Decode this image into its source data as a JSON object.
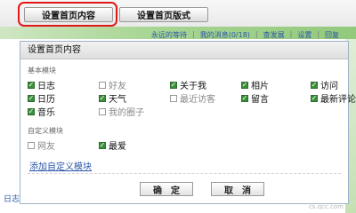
{
  "toolbar": {
    "set_home_content_label": "设置首页内容",
    "set_home_style_label": "设置首页版式"
  },
  "header_links": [
    "永远的等待",
    "我的消息(0/18)",
    "查发展",
    "设置",
    "回复"
  ],
  "dialog": {
    "title": "设置首页内容",
    "basic_section_label": "基本模块",
    "custom_section_label": "自定义模块",
    "basic_options": [
      {
        "label": "日志",
        "checked": true
      },
      {
        "label": "好友",
        "checked": false
      },
      {
        "label": "关于我",
        "checked": true
      },
      {
        "label": "相片",
        "checked": true
      },
      {
        "label": "访问",
        "checked": true
      },
      {
        "label": "日历",
        "checked": true
      },
      {
        "label": "天气",
        "checked": true
      },
      {
        "label": "最近访客",
        "checked": false
      },
      {
        "label": "留言",
        "checked": true
      },
      {
        "label": "最新评论",
        "checked": true
      },
      {
        "label": "音乐",
        "checked": true
      },
      {
        "label": "我的圈子",
        "checked": false
      }
    ],
    "custom_options": [
      {
        "label": "网友",
        "checked": false
      },
      {
        "label": "最爱",
        "checked": true
      }
    ],
    "add_custom_link": "添加自定义模块",
    "ok_label": "确　定",
    "cancel_label": "取　消"
  },
  "footer": {
    "left_text": "日志"
  },
  "watermark": "cs.qcc.com"
}
